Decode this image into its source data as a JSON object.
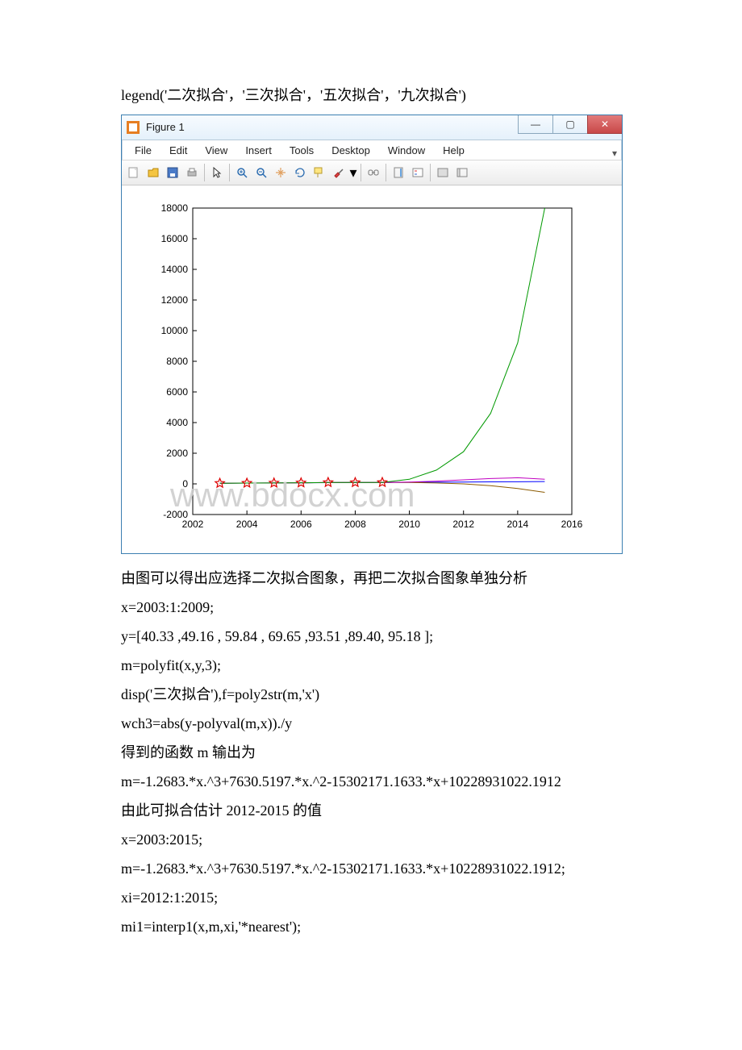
{
  "doc": {
    "line1": "legend('二次拟合'，'三次拟合'，'五次拟合'，'九次拟合')",
    "after_fig_1": "由图可以得出应选择二次拟合图象，再把二次拟合图象单独分析",
    "after_fig_2": "x=2003:1:2009;",
    "after_fig_3": "y=[40.33 ,49.16 , 59.84 , 69.65 ,93.51 ,89.40, 95.18 ];",
    "after_fig_4": "m=polyfit(x,y,3);",
    "after_fig_5": "disp('三次拟合'),f=poly2str(m,'x')",
    "after_fig_6": "wch3=abs(y-polyval(m,x))./y",
    "after_fig_7": "得到的函数 m 输出为",
    "after_fig_8": "m=-1.2683.*x.^3+7630.5197.*x.^2-15302171.1633.*x+10228931022.1912",
    "after_fig_9": "由此可拟合估计 2012-2015 的值",
    "after_fig_10": "x=2003:2015;",
    "after_fig_11": "m=-1.2683.*x.^3+7630.5197.*x.^2-15302171.1633.*x+10228931022.1912;",
    "after_fig_12": "xi=2012:1:2015;",
    "after_fig_13": "mi1=interp1(x,m,xi,'*nearest');"
  },
  "figure": {
    "title": "Figure 1",
    "menus": [
      "File",
      "Edit",
      "View",
      "Insert",
      "Tools",
      "Desktop",
      "Window",
      "Help"
    ],
    "winbtn_min": "—",
    "winbtn_max": "▢",
    "winbtn_close": "✕",
    "watermark": "www.bdocx.com"
  },
  "chart_data": {
    "type": "line",
    "title": "",
    "xlabel": "",
    "ylabel": "",
    "xlim": [
      2002,
      2016
    ],
    "ylim": [
      -2000,
      18000
    ],
    "xticks": [
      2002,
      2004,
      2006,
      2008,
      2010,
      2012,
      2014,
      2016
    ],
    "yticks": [
      -2000,
      0,
      2000,
      4000,
      6000,
      8000,
      10000,
      12000,
      14000,
      16000,
      18000
    ],
    "markers": {
      "x": [
        2003,
        2004,
        2005,
        2006,
        2007,
        2008,
        2009
      ],
      "y": [
        40.33,
        49.16,
        59.84,
        69.65,
        93.51,
        89.4,
        95.18
      ],
      "style": "red-pentagram"
    },
    "series": [
      {
        "name": "二次拟合",
        "color": "#0000ff",
        "x": [
          2003,
          2004,
          2005,
          2006,
          2007,
          2008,
          2009,
          2010,
          2011,
          2012,
          2013,
          2014,
          2015
        ],
        "y": [
          40,
          50,
          60,
          70,
          80,
          90,
          95,
          100,
          110,
          120,
          130,
          140,
          150
        ]
      },
      {
        "name": "三次拟合",
        "color": "#8b5a00",
        "x": [
          2003,
          2004,
          2005,
          2006,
          2007,
          2008,
          2009,
          2010,
          2011,
          2012,
          2013,
          2014,
          2015
        ],
        "y": [
          40,
          50,
          60,
          70,
          85,
          90,
          95,
          90,
          60,
          0,
          -120,
          -300,
          -550
        ]
      },
      {
        "name": "五次拟合",
        "color": "#c000c0",
        "x": [
          2003,
          2004,
          2005,
          2006,
          2007,
          2008,
          2009,
          2010,
          2011,
          2012,
          2013,
          2014,
          2015
        ],
        "y": [
          40,
          50,
          60,
          70,
          90,
          90,
          95,
          120,
          180,
          260,
          350,
          400,
          300
        ]
      },
      {
        "name": "九次拟合",
        "color": "#009900",
        "x": [
          2003,
          2004,
          2005,
          2006,
          2007,
          2008,
          2009,
          2010,
          2011,
          2012,
          2013,
          2014,
          2015
        ],
        "y": [
          40,
          50,
          60,
          70,
          90,
          90,
          95,
          300,
          900,
          2100,
          4600,
          9200,
          18000
        ]
      }
    ]
  }
}
